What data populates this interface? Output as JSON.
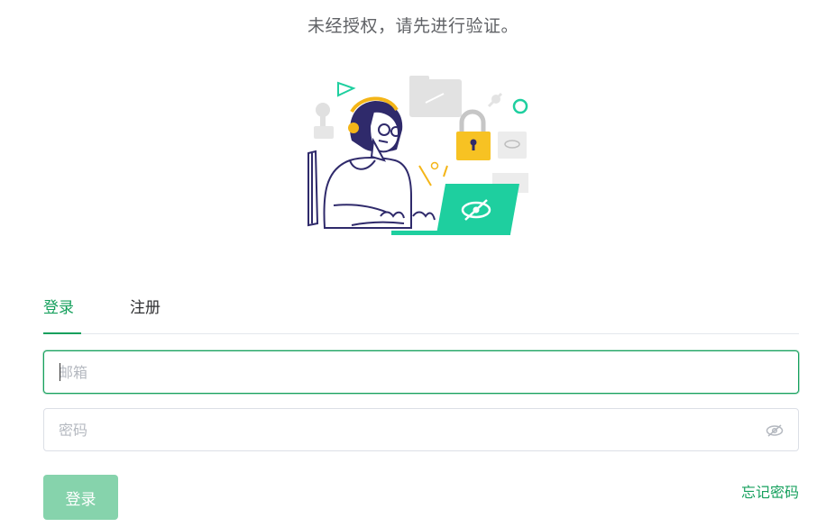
{
  "notice": "未经授权，请先进行验证。",
  "tabs": {
    "login": "登录",
    "register": "注册",
    "active": "login"
  },
  "form": {
    "email": {
      "placeholder": "邮箱",
      "value": ""
    },
    "password": {
      "placeholder": "密码",
      "value": ""
    },
    "password_toggle_icon": "eye-slash-icon",
    "submit_label": "登录",
    "forgot_label": "忘记密码"
  },
  "colors": {
    "accent": "#16a05d",
    "button_disabled": "#86d3ac",
    "border": "#dcdfe6",
    "laptop": "#1ecf9f",
    "lock": "#f7c223",
    "hair": "#2f2a6b",
    "headband": "#f4b518"
  }
}
